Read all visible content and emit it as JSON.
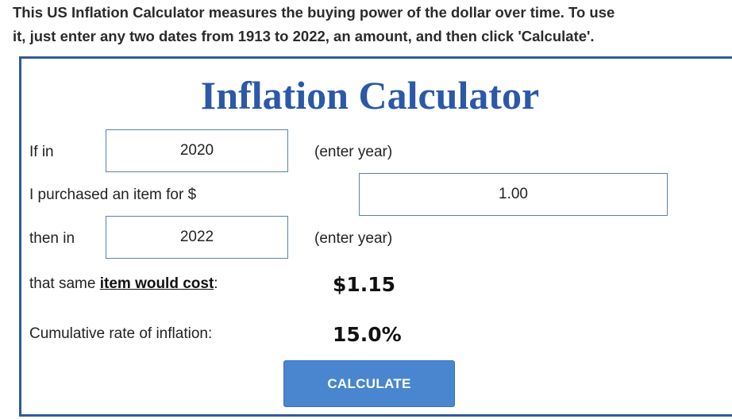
{
  "intro": {
    "line1": "This US Inflation Calculator measures the buying power of the dollar over time. To use",
    "line2": "it, just enter any two dates from 1913 to 2022, an amount, and then click 'Calculate'."
  },
  "calculator": {
    "title": "Inflation Calculator",
    "start_year": {
      "label": "If in",
      "value": "2020",
      "hint": "(enter year)"
    },
    "amount": {
      "label": "I purchased an item for $",
      "value": "1.00"
    },
    "end_year": {
      "label": "then in",
      "value": "2022",
      "hint": "(enter year)"
    },
    "cost": {
      "prefix": "that same ",
      "link": "item would cost",
      "suffix": ":",
      "value": "$1.15"
    },
    "inflation": {
      "label": "Cumulative rate of inflation:",
      "value": "15.0%"
    },
    "button_label": "CALCULATE"
  },
  "colors": {
    "title": "#2b58a8",
    "border": "#2f5a9c",
    "button": "#4a86cf"
  }
}
